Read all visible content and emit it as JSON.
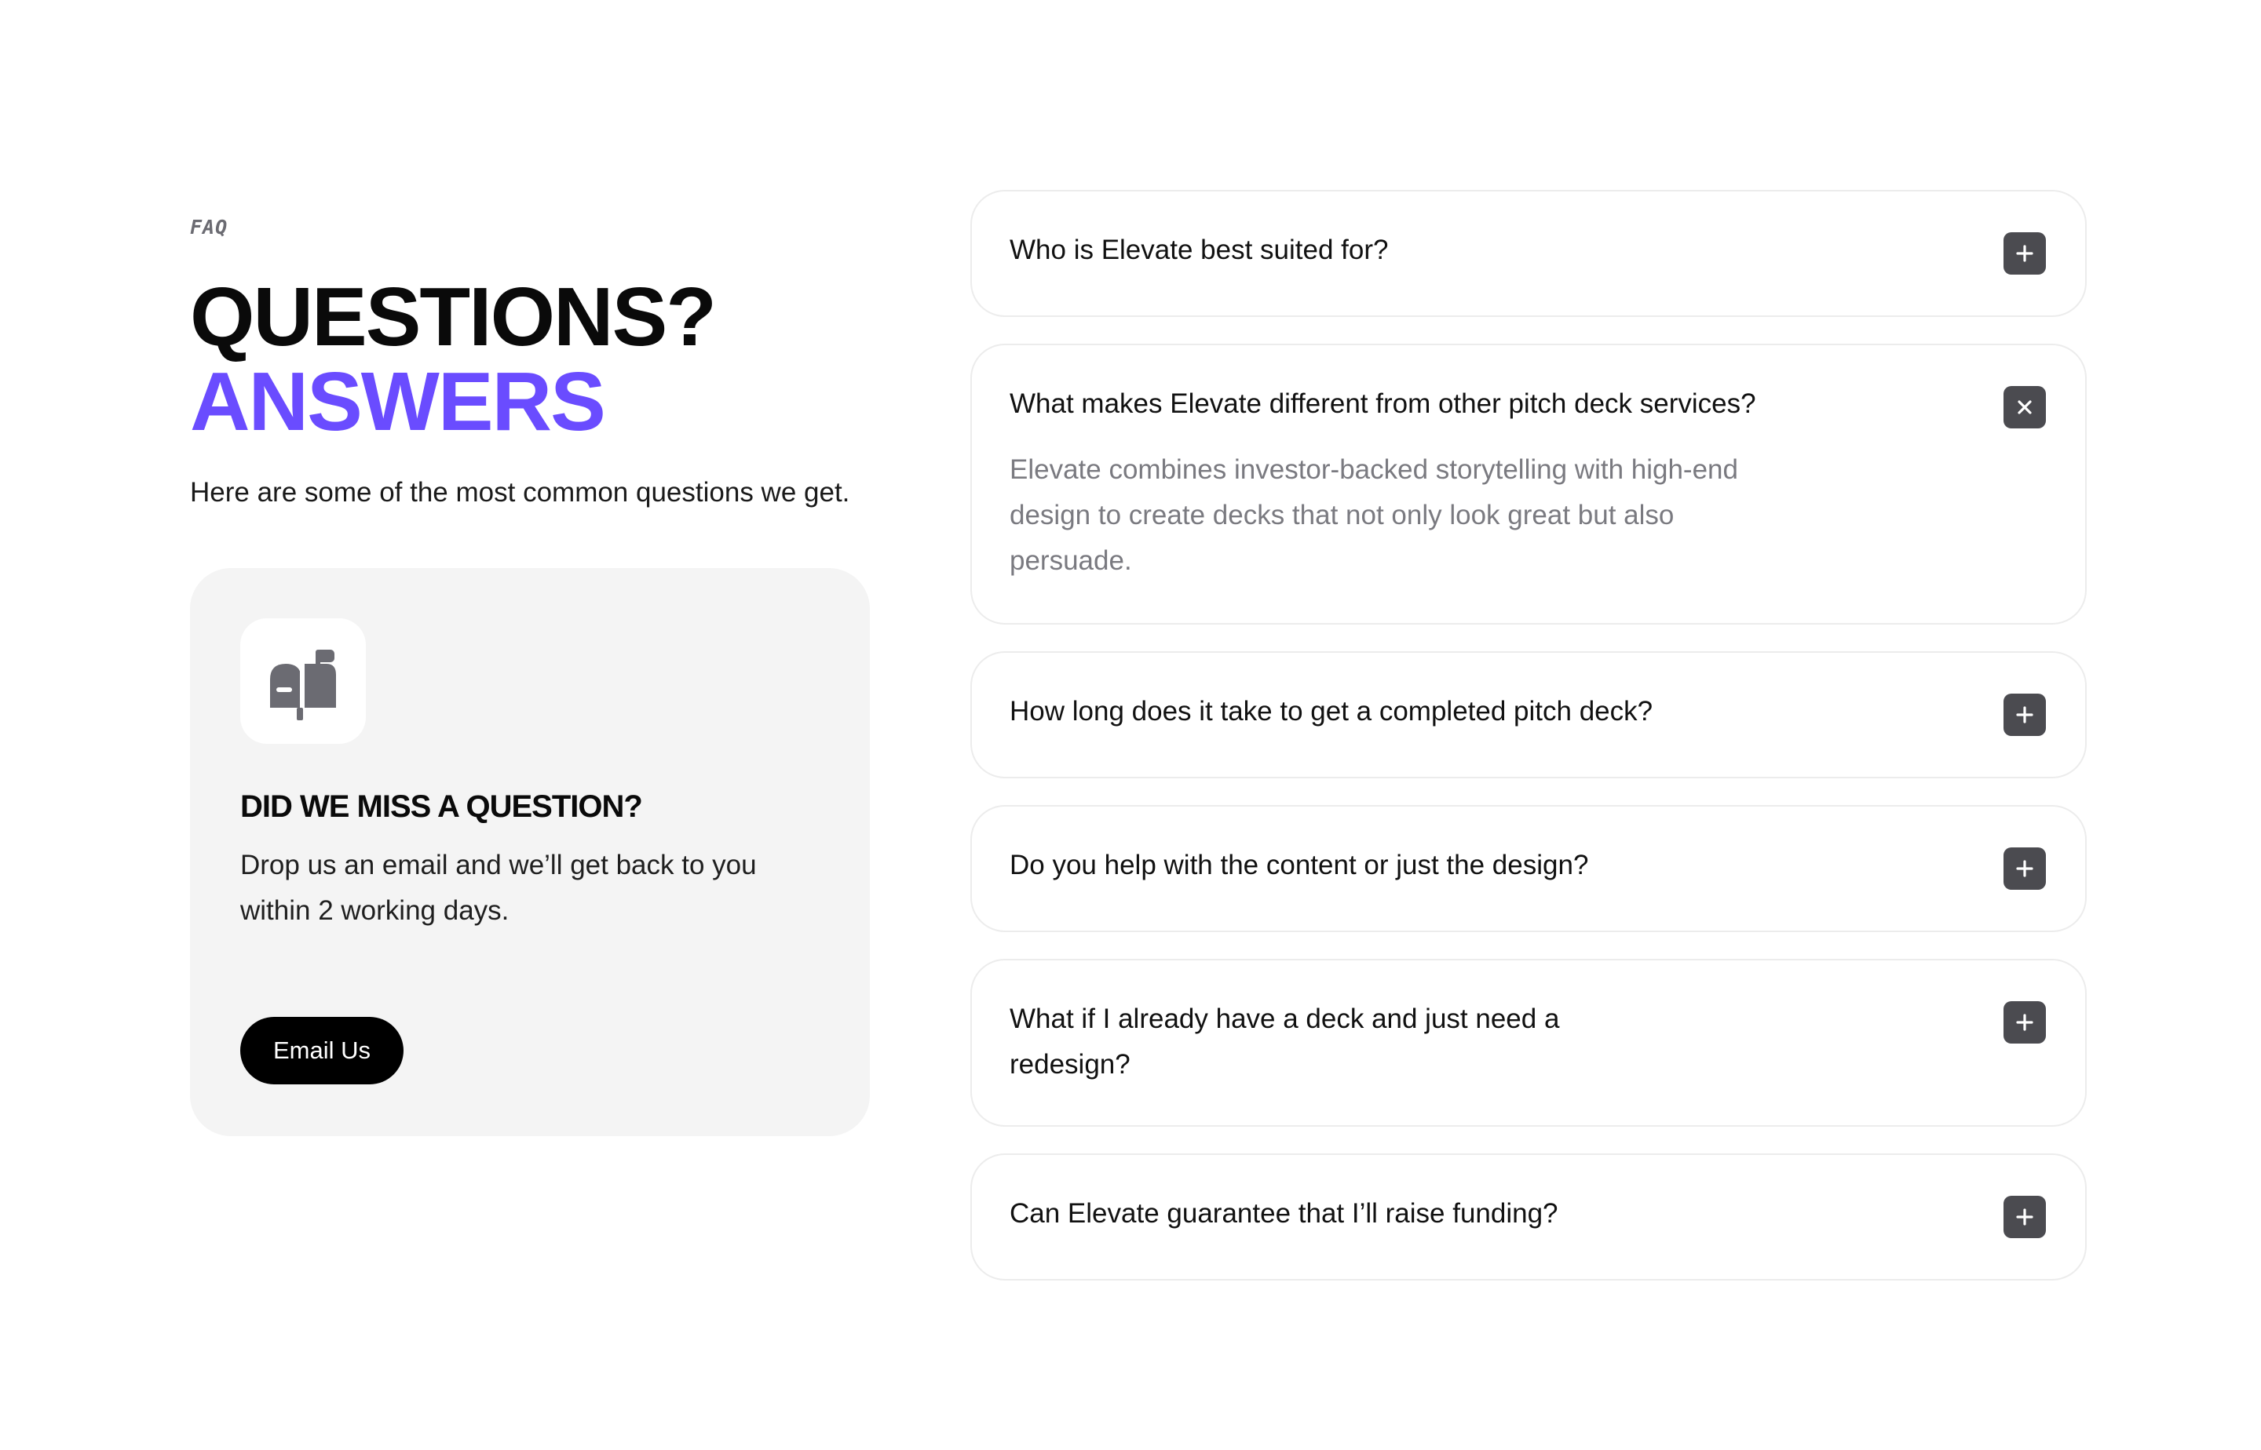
{
  "section": {
    "eyebrow": "FAQ",
    "heading_line1": "QUESTIONS?",
    "heading_line2": "ANSWERS",
    "intro": "Here are some of the most common questions we get."
  },
  "help_card": {
    "icon": "mailbox-icon",
    "title": "DID WE MISS A QUESTION?",
    "text": "Drop us an email and we’ll get back to you within 2 working days.",
    "button_label": "Email Us"
  },
  "faq": {
    "items": [
      {
        "question": "Who is Elevate best suited for?",
        "expanded": false,
        "toggle_icon": "plus-icon"
      },
      {
        "question": "What makes Elevate different from other pitch deck services?",
        "answer": "Elevate combines investor-backed storytelling with high-end design to create decks that not only look great but also persuade.",
        "expanded": true,
        "toggle_icon": "close-icon"
      },
      {
        "question": "How long does it take to get a completed pitch deck?",
        "expanded": false,
        "toggle_icon": "plus-icon"
      },
      {
        "question": "Do you help with the content or just the design?",
        "expanded": false,
        "toggle_icon": "plus-icon"
      },
      {
        "question": "What if I already have a deck and just need a redesign?",
        "expanded": false,
        "toggle_icon": "plus-icon"
      },
      {
        "question": "Can Elevate guarantee that I’ll raise funding?",
        "expanded": false,
        "toggle_icon": "plus-icon"
      }
    ]
  },
  "colors": {
    "accent": "#6a4cff",
    "toggle_bg": "#4b4b50",
    "card_bg": "#f4f4f4",
    "answer_text": "#7a7a80"
  }
}
